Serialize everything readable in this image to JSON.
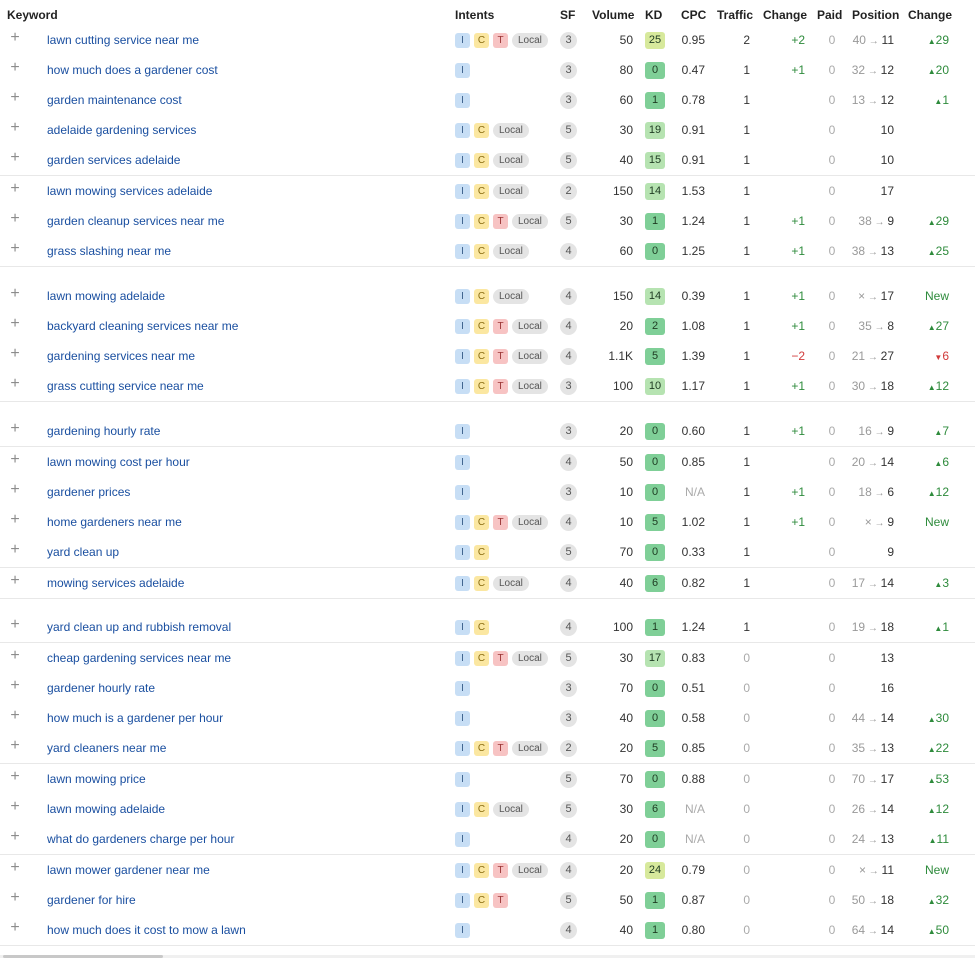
{
  "columns": {
    "keyword": "Keyword",
    "intents": "Intents",
    "sf": "SF",
    "volume": "Volume",
    "kd": "KD",
    "cpc": "CPC",
    "traffic": "Traffic",
    "change": "Change",
    "paid": "Paid",
    "position": "Position",
    "position_change": "Change"
  },
  "icons": {
    "add": "plus-icon",
    "arrow": "arrow-right-icon",
    "up": "triangle-up-icon",
    "down": "triangle-down-icon"
  },
  "colors": {
    "keyword_link": "#1a4fa0",
    "positive": "#2e8b3c",
    "negative": "#d13a3a",
    "kd_easy": "#7fcf97",
    "kd_low": "#b6e3b1",
    "kd_mid": "#d7e99c"
  },
  "rows": [
    {
      "keyword": "lawn cutting service near me",
      "intents": [
        "I",
        "C",
        "T",
        "Local"
      ],
      "sf": "3",
      "volume": "50",
      "kd": "25",
      "cpc": "0.95",
      "traffic": "2",
      "change": "+2",
      "paid": "0",
      "pos_prev": "40",
      "pos": "11",
      "pos_change": "29",
      "pos_dir": "up"
    },
    {
      "keyword": "how much does a gardener cost",
      "intents": [
        "I"
      ],
      "sf": "3",
      "volume": "80",
      "kd": "0",
      "cpc": "0.47",
      "traffic": "1",
      "change": "+1",
      "paid": "0",
      "pos_prev": "32",
      "pos": "12",
      "pos_change": "20",
      "pos_dir": "up"
    },
    {
      "keyword": "garden maintenance cost",
      "intents": [
        "I"
      ],
      "sf": "3",
      "volume": "60",
      "kd": "1",
      "cpc": "0.78",
      "traffic": "1",
      "change": "",
      "paid": "0",
      "pos_prev": "13",
      "pos": "12",
      "pos_change": "1",
      "pos_dir": "up"
    },
    {
      "keyword": "adelaide gardening services",
      "intents": [
        "I",
        "C",
        "Local"
      ],
      "sf": "5",
      "volume": "30",
      "kd": "19",
      "cpc": "0.91",
      "traffic": "1",
      "change": "",
      "paid": "0",
      "pos_prev": "",
      "pos": "10",
      "pos_change": "",
      "pos_dir": ""
    },
    {
      "keyword": "garden services adelaide",
      "intents": [
        "I",
        "C",
        "Local"
      ],
      "sf": "5",
      "volume": "40",
      "kd": "15",
      "cpc": "0.91",
      "traffic": "1",
      "change": "",
      "paid": "0",
      "pos_prev": "",
      "pos": "10",
      "pos_change": "",
      "pos_dir": ""
    },
    {
      "keyword": "lawn mowing services adelaide",
      "intents": [
        "I",
        "C",
        "Local"
      ],
      "sf": "2",
      "volume": "150",
      "kd": "14",
      "cpc": "1.53",
      "traffic": "1",
      "change": "",
      "paid": "0",
      "pos_prev": "",
      "pos": "17",
      "pos_change": "",
      "pos_dir": ""
    },
    {
      "keyword": "garden cleanup services near me",
      "intents": [
        "I",
        "C",
        "T",
        "Local"
      ],
      "sf": "5",
      "volume": "30",
      "kd": "1",
      "cpc": "1.24",
      "traffic": "1",
      "change": "+1",
      "paid": "0",
      "pos_prev": "38",
      "pos": "9",
      "pos_change": "29",
      "pos_dir": "up"
    },
    {
      "keyword": "grass slashing near me",
      "intents": [
        "I",
        "C",
        "Local"
      ],
      "sf": "4",
      "volume": "60",
      "kd": "0",
      "cpc": "1.25",
      "traffic": "1",
      "change": "+1",
      "paid": "0",
      "pos_prev": "38",
      "pos": "13",
      "pos_change": "25",
      "pos_dir": "up"
    },
    {
      "keyword": "lawn mowing adelaide",
      "intents": [
        "I",
        "C",
        "Local"
      ],
      "sf": "4",
      "volume": "150",
      "kd": "14",
      "cpc": "0.39",
      "traffic": "1",
      "change": "+1",
      "paid": "0",
      "pos_prev": "×",
      "pos": "17",
      "pos_change": "New",
      "pos_dir": "new"
    },
    {
      "keyword": "backyard cleaning services near me",
      "intents": [
        "I",
        "C",
        "T",
        "Local"
      ],
      "sf": "4",
      "volume": "20",
      "kd": "2",
      "cpc": "1.08",
      "traffic": "1",
      "change": "+1",
      "paid": "0",
      "pos_prev": "35",
      "pos": "8",
      "pos_change": "27",
      "pos_dir": "up"
    },
    {
      "keyword": "gardening services near me",
      "intents": [
        "I",
        "C",
        "T",
        "Local"
      ],
      "sf": "4",
      "volume": "1.1K",
      "kd": "5",
      "cpc": "1.39",
      "traffic": "1",
      "change": "−2",
      "paid": "0",
      "pos_prev": "21",
      "pos": "27",
      "pos_change": "6",
      "pos_dir": "down"
    },
    {
      "keyword": "grass cutting service near me",
      "intents": [
        "I",
        "C",
        "T",
        "Local"
      ],
      "sf": "3",
      "volume": "100",
      "kd": "10",
      "cpc": "1.17",
      "traffic": "1",
      "change": "+1",
      "paid": "0",
      "pos_prev": "30",
      "pos": "18",
      "pos_change": "12",
      "pos_dir": "up"
    },
    {
      "keyword": "gardening hourly rate",
      "intents": [
        "I"
      ],
      "sf": "3",
      "volume": "20",
      "kd": "0",
      "cpc": "0.60",
      "traffic": "1",
      "change": "+1",
      "paid": "0",
      "pos_prev": "16",
      "pos": "9",
      "pos_change": "7",
      "pos_dir": "up"
    },
    {
      "keyword": "lawn mowing cost per hour",
      "intents": [
        "I"
      ],
      "sf": "4",
      "volume": "50",
      "kd": "0",
      "cpc": "0.85",
      "traffic": "1",
      "change": "",
      "paid": "0",
      "pos_prev": "20",
      "pos": "14",
      "pos_change": "6",
      "pos_dir": "up"
    },
    {
      "keyword": "gardener prices",
      "intents": [
        "I"
      ],
      "sf": "3",
      "volume": "10",
      "kd": "0",
      "cpc": "N/A",
      "traffic": "1",
      "change": "+1",
      "paid": "0",
      "pos_prev": "18",
      "pos": "6",
      "pos_change": "12",
      "pos_dir": "up"
    },
    {
      "keyword": "home gardeners near me",
      "intents": [
        "I",
        "C",
        "T",
        "Local"
      ],
      "sf": "4",
      "volume": "10",
      "kd": "5",
      "cpc": "1.02",
      "traffic": "1",
      "change": "+1",
      "paid": "0",
      "pos_prev": "×",
      "pos": "9",
      "pos_change": "New",
      "pos_dir": "new"
    },
    {
      "keyword": "yard clean up",
      "intents": [
        "I",
        "C"
      ],
      "sf": "5",
      "volume": "70",
      "kd": "0",
      "cpc": "0.33",
      "traffic": "1",
      "change": "",
      "paid": "0",
      "pos_prev": "",
      "pos": "9",
      "pos_change": "",
      "pos_dir": ""
    },
    {
      "keyword": "mowing services adelaide",
      "intents": [
        "I",
        "C",
        "Local"
      ],
      "sf": "4",
      "volume": "40",
      "kd": "6",
      "cpc": "0.82",
      "traffic": "1",
      "change": "",
      "paid": "0",
      "pos_prev": "17",
      "pos": "14",
      "pos_change": "3",
      "pos_dir": "up"
    },
    {
      "keyword": "yard clean up and rubbish removal",
      "intents": [
        "I",
        "C"
      ],
      "sf": "4",
      "volume": "100",
      "kd": "1",
      "cpc": "1.24",
      "traffic": "1",
      "change": "",
      "paid": "0",
      "pos_prev": "19",
      "pos": "18",
      "pos_change": "1",
      "pos_dir": "up"
    },
    {
      "keyword": "cheap gardening services near me",
      "intents": [
        "I",
        "C",
        "T",
        "Local"
      ],
      "sf": "5",
      "volume": "30",
      "kd": "17",
      "cpc": "0.83",
      "traffic": "0",
      "change": "",
      "paid": "0",
      "pos_prev": "",
      "pos": "13",
      "pos_change": "",
      "pos_dir": ""
    },
    {
      "keyword": "gardener hourly rate",
      "intents": [
        "I"
      ],
      "sf": "3",
      "volume": "70",
      "kd": "0",
      "cpc": "0.51",
      "traffic": "0",
      "change": "",
      "paid": "0",
      "pos_prev": "",
      "pos": "16",
      "pos_change": "",
      "pos_dir": ""
    },
    {
      "keyword": "how much is a gardener per hour",
      "intents": [
        "I"
      ],
      "sf": "3",
      "volume": "40",
      "kd": "0",
      "cpc": "0.58",
      "traffic": "0",
      "change": "",
      "paid": "0",
      "pos_prev": "44",
      "pos": "14",
      "pos_change": "30",
      "pos_dir": "up"
    },
    {
      "keyword": "yard cleaners near me",
      "intents": [
        "I",
        "C",
        "T",
        "Local"
      ],
      "sf": "2",
      "volume": "20",
      "kd": "5",
      "cpc": "0.85",
      "traffic": "0",
      "change": "",
      "paid": "0",
      "pos_prev": "35",
      "pos": "13",
      "pos_change": "22",
      "pos_dir": "up"
    },
    {
      "keyword": "lawn mowing price",
      "intents": [
        "I"
      ],
      "sf": "5",
      "volume": "70",
      "kd": "0",
      "cpc": "0.88",
      "traffic": "0",
      "change": "",
      "paid": "0",
      "pos_prev": "70",
      "pos": "17",
      "pos_change": "53",
      "pos_dir": "up"
    },
    {
      "keyword": "lawn mowing adelaide",
      "intents": [
        "I",
        "C",
        "Local"
      ],
      "sf": "5",
      "volume": "30",
      "kd": "6",
      "cpc": "N/A",
      "traffic": "0",
      "change": "",
      "paid": "0",
      "pos_prev": "26",
      "pos": "14",
      "pos_change": "12",
      "pos_dir": "up"
    },
    {
      "keyword": "what do gardeners charge per hour",
      "intents": [
        "I"
      ],
      "sf": "4",
      "volume": "20",
      "kd": "0",
      "cpc": "N/A",
      "traffic": "0",
      "change": "",
      "paid": "0",
      "pos_prev": "24",
      "pos": "13",
      "pos_change": "11",
      "pos_dir": "up"
    },
    {
      "keyword": "lawn mower gardener near me",
      "intents": [
        "I",
        "C",
        "T",
        "Local"
      ],
      "sf": "4",
      "volume": "20",
      "kd": "24",
      "cpc": "0.79",
      "traffic": "0",
      "change": "",
      "paid": "0",
      "pos_prev": "×",
      "pos": "11",
      "pos_change": "New",
      "pos_dir": "new"
    },
    {
      "keyword": "gardener for hire",
      "intents": [
        "I",
        "C",
        "T"
      ],
      "sf": "5",
      "volume": "50",
      "kd": "1",
      "cpc": "0.87",
      "traffic": "0",
      "change": "",
      "paid": "0",
      "pos_prev": "50",
      "pos": "18",
      "pos_change": "32",
      "pos_dir": "up"
    },
    {
      "keyword": "how much does it cost to mow a lawn",
      "intents": [
        "I"
      ],
      "sf": "4",
      "volume": "40",
      "kd": "1",
      "cpc": "0.80",
      "traffic": "0",
      "change": "",
      "paid": "0",
      "pos_prev": "64",
      "pos": "14",
      "pos_change": "50",
      "pos_dir": "up"
    }
  ]
}
